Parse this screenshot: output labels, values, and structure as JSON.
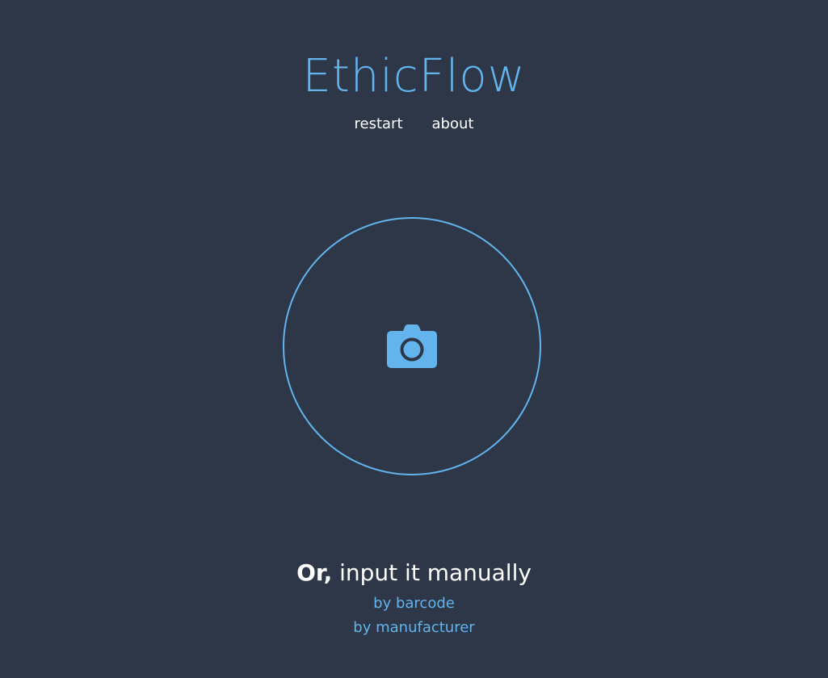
{
  "app": {
    "name": "EthicFlow"
  },
  "nav": {
    "items": [
      {
        "label": "restart"
      },
      {
        "label": "about"
      }
    ]
  },
  "scanner": {
    "icon": "camera-icon"
  },
  "manual": {
    "heading_bold": "Or,",
    "heading_rest": " input it manually",
    "links": [
      {
        "label": "by barcode"
      },
      {
        "label": "by manufacturer"
      }
    ]
  },
  "colors": {
    "background": "#2d3748",
    "accent": "#63b3ed",
    "text": "#ffffff"
  }
}
